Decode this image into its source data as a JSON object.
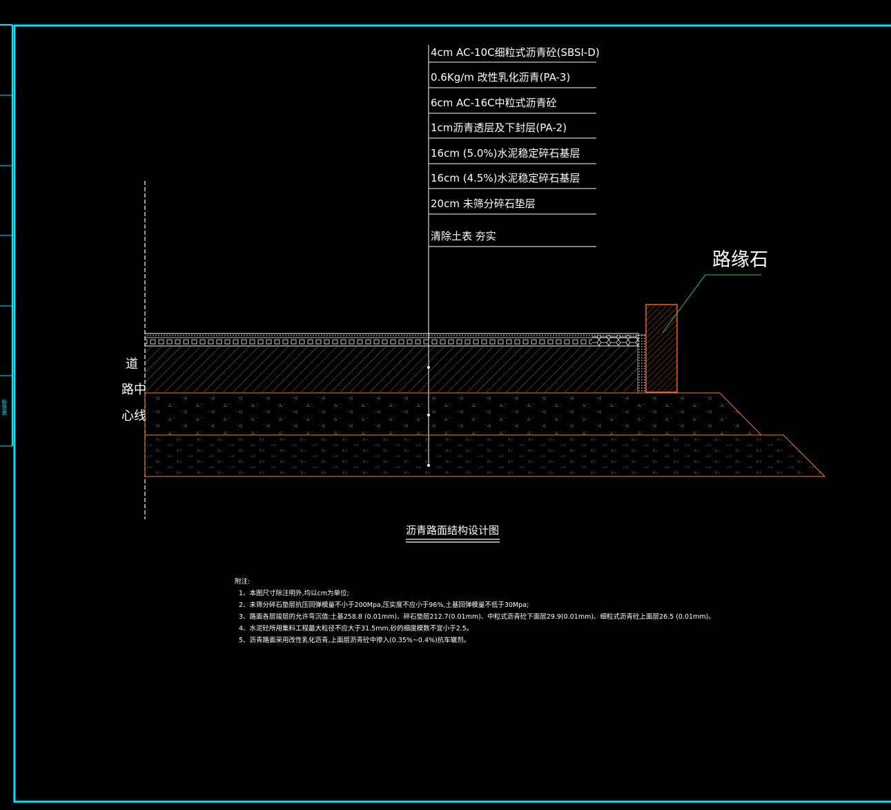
{
  "layers": [
    "4cm AC-10C细粒式沥青砼(SBSI-D)",
    "0.6Kg/m 改性乳化沥青(PA-3)",
    "6cm AC-16C中粒式沥青砼",
    "1cm沥青透层及下封层(PA-2)",
    "16cm (5.0%)水泥稳定碎石基层",
    "16cm (4.5%)水泥稳定碎石基层",
    "20cm 未筛分碎石垫层",
    "清除土表 夯实"
  ],
  "curb_label": "路缘石",
  "centerline_label": [
    "道",
    "路中",
    "心线"
  ],
  "drawing_title": "沥青路面结构设计图",
  "notes": {
    "heading": "附注:",
    "items": [
      "1、本图尺寸除注明外,均以cm为单位;",
      "2、未筛分碎石垫层抗压回弹模量不小于200Mpa,压实度不应小于96%,土基回弹模量不低于30Mpa;",
      "3、路面各层竣层的允许弯沉值:土基258.8 (0.01mm)、碎石垫层212.7(0.01mm)、中粒式沥青砼下面层29.9(0.01mm)、细粒式沥青砼上面层26.5 (0.01mm)。",
      "4、水泥砼所用集料工程最大粒径不应大于31.5mm,砂的细度模数不宜小于2.5。",
      "5、沥青路面采用改性乳化沥青,上面层沥青砼中掺入(0.35%~0.4%)抗车辙剂。"
    ]
  },
  "side_tag": "标签表",
  "colors": {
    "frame": "#00e5ff",
    "layer_edge": "#ff7a1a",
    "curb": "#ff6b1a",
    "leader": "#33cc33",
    "text": "#ffffff"
  }
}
